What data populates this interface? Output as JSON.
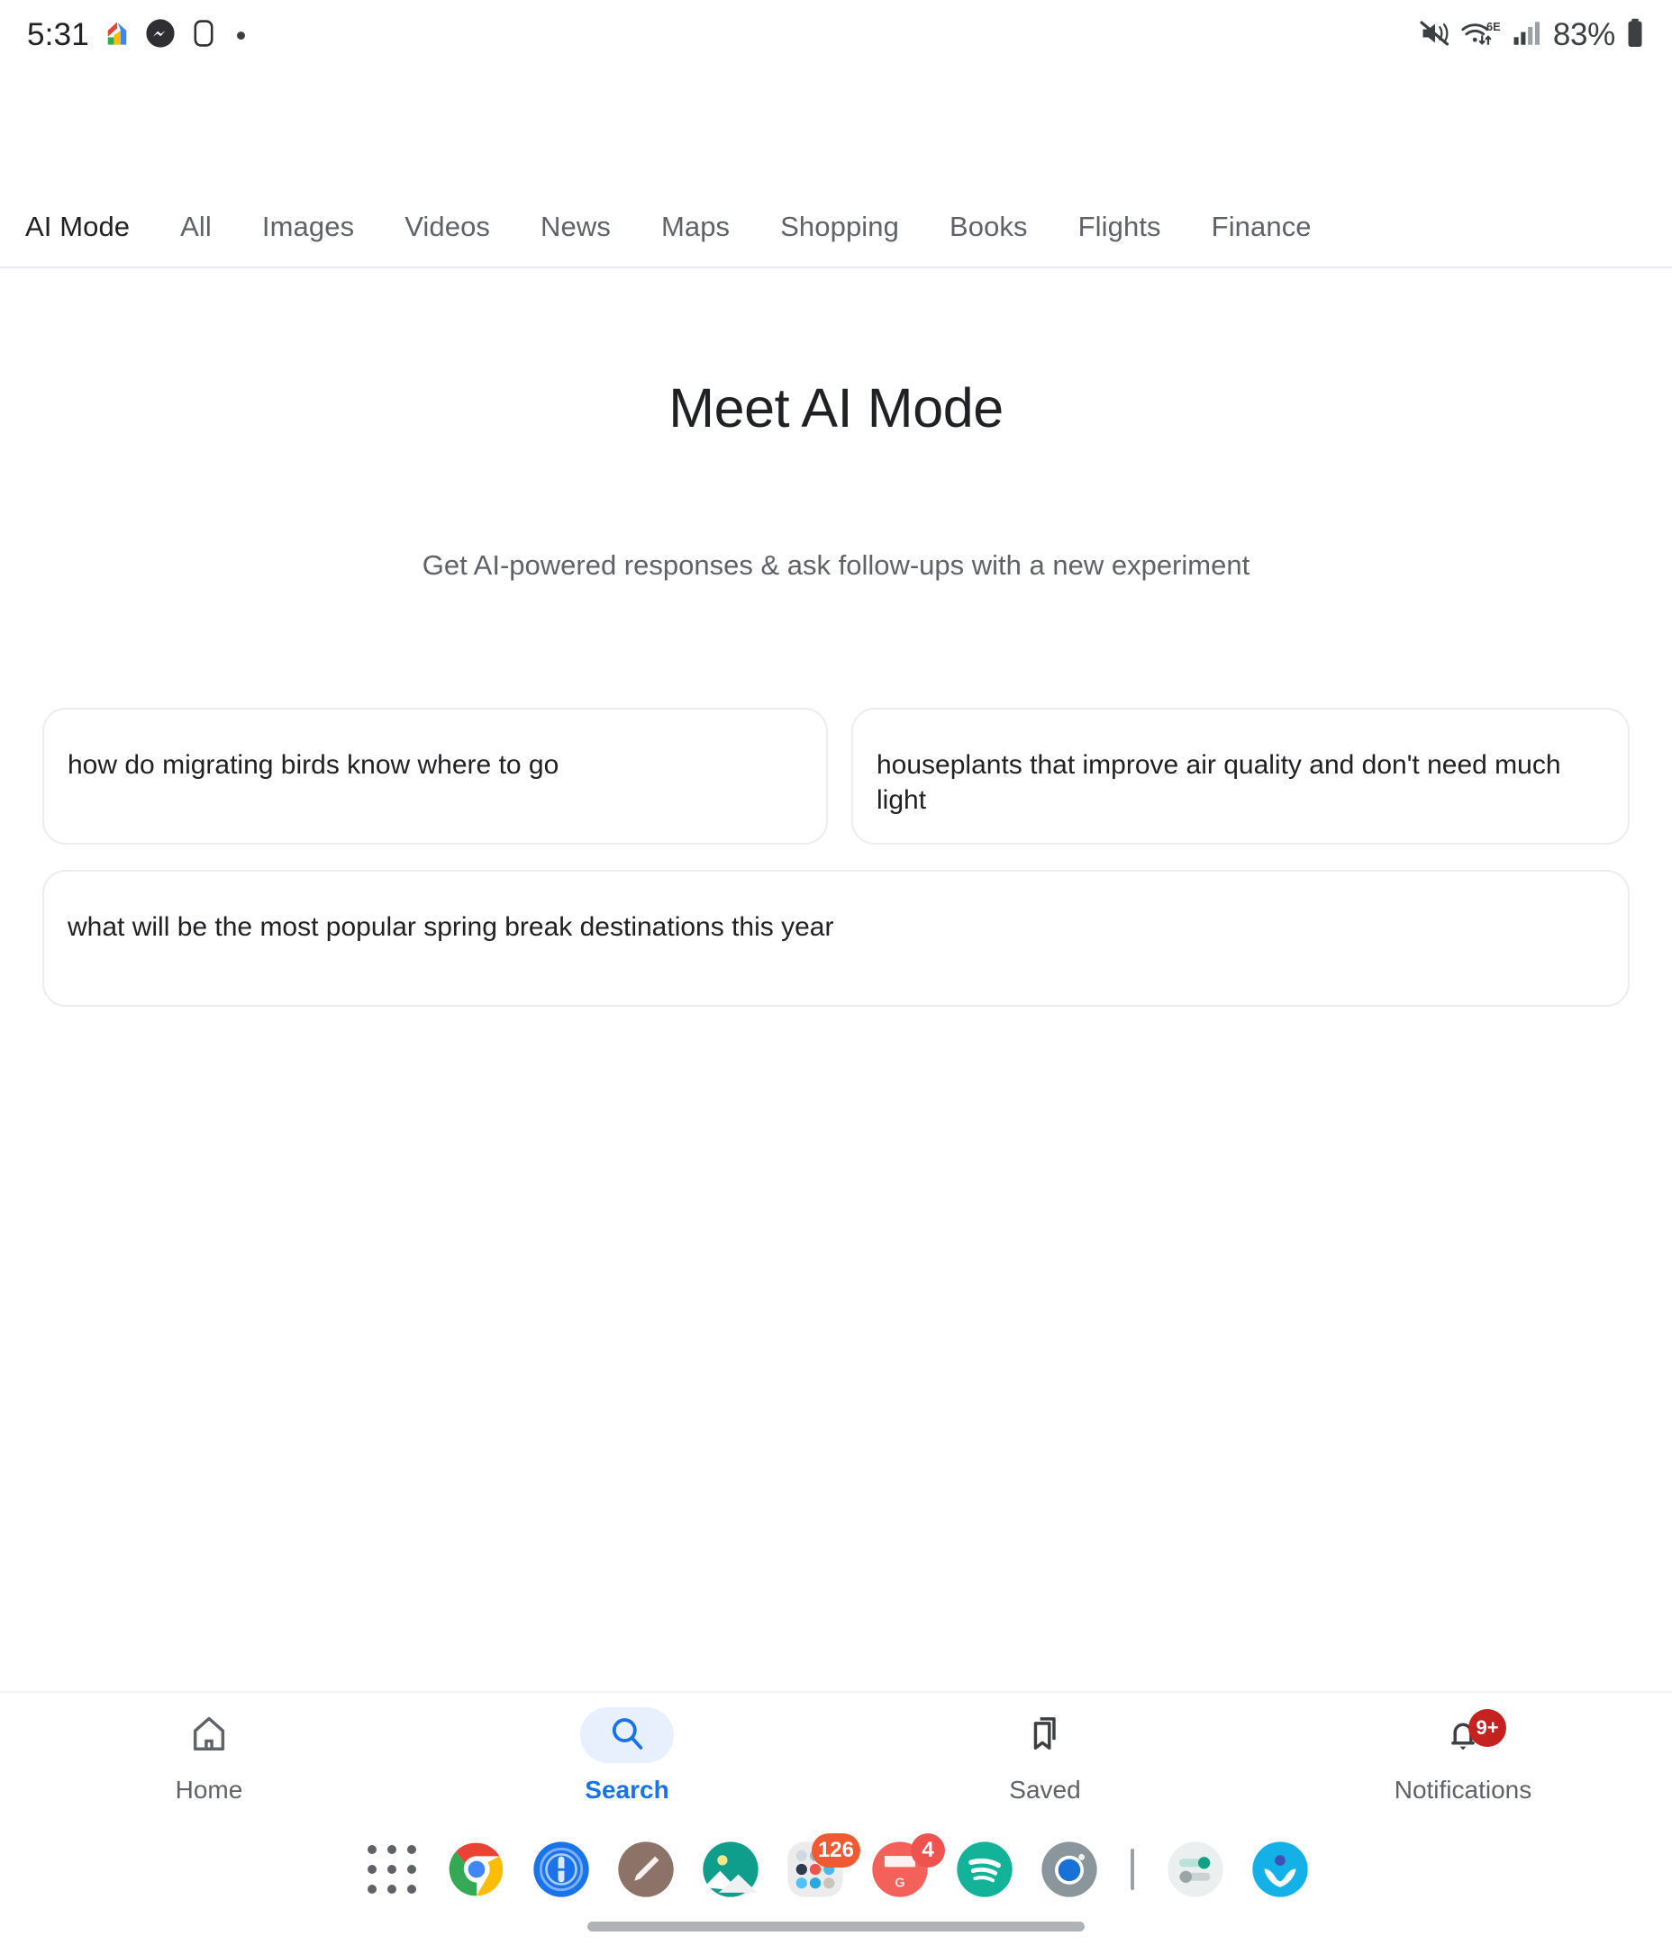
{
  "status_bar": {
    "time": "5:31",
    "battery_percent": "83%",
    "left_icons": [
      "google-home-icon",
      "messenger-icon",
      "app-square-icon",
      "dot-indicator"
    ],
    "right_icons": [
      "mute-vibrate-icon",
      "wifi-6e-icon",
      "cellular-signal-icon",
      "battery-icon"
    ],
    "wifi_label": "6E"
  },
  "tabs": [
    {
      "label": "AI Mode",
      "active": true
    },
    {
      "label": "All",
      "active": false
    },
    {
      "label": "Images",
      "active": false
    },
    {
      "label": "Videos",
      "active": false
    },
    {
      "label": "News",
      "active": false
    },
    {
      "label": "Maps",
      "active": false
    },
    {
      "label": "Shopping",
      "active": false
    },
    {
      "label": "Books",
      "active": false
    },
    {
      "label": "Flights",
      "active": false
    },
    {
      "label": "Finance",
      "active": false
    }
  ],
  "hero": {
    "title": "Meet AI Mode",
    "subtitle": "Get AI-powered responses & ask follow-ups with a new experiment"
  },
  "suggestions": [
    {
      "text": "how do migrating birds know where to go"
    },
    {
      "text": "houseplants that improve air quality and don't need much light"
    },
    {
      "text": "what will be the most popular spring break destinations this year"
    }
  ],
  "bottom_nav": {
    "items": [
      {
        "label": "Home",
        "icon": "home-icon",
        "active": false,
        "badge": null
      },
      {
        "label": "Search",
        "icon": "search-icon",
        "active": true,
        "badge": null
      },
      {
        "label": "Saved",
        "icon": "bookmark-icon",
        "active": false,
        "badge": null
      },
      {
        "label": "Notifications",
        "icon": "bell-icon",
        "active": false,
        "badge": "9+"
      }
    ],
    "active_color": "#1a73e8",
    "inactive_color": "#5f6368",
    "active_pill_color": "#e8f0fe",
    "badge_color": "#c5221f"
  },
  "dock": {
    "items": [
      {
        "name": "app-drawer-icon",
        "badge": null
      },
      {
        "name": "chrome-icon",
        "badge": null
      },
      {
        "name": "onepassword-icon",
        "badge": null
      },
      {
        "name": "notes-pencil-icon",
        "badge": null
      },
      {
        "name": "gallery-icon",
        "badge": null
      },
      {
        "name": "app-folder-icon",
        "badge": "126"
      },
      {
        "name": "gmail-icon",
        "badge": "4"
      },
      {
        "name": "spotify-icon",
        "badge": null
      },
      {
        "name": "camera-icon",
        "badge": null
      },
      {
        "name": "dock-divider",
        "badge": null
      },
      {
        "name": "settings-icon",
        "badge": null
      },
      {
        "name": "health-app-icon",
        "badge": null
      }
    ]
  },
  "gesture_bar": {
    "label": "home-gesture-handle"
  }
}
